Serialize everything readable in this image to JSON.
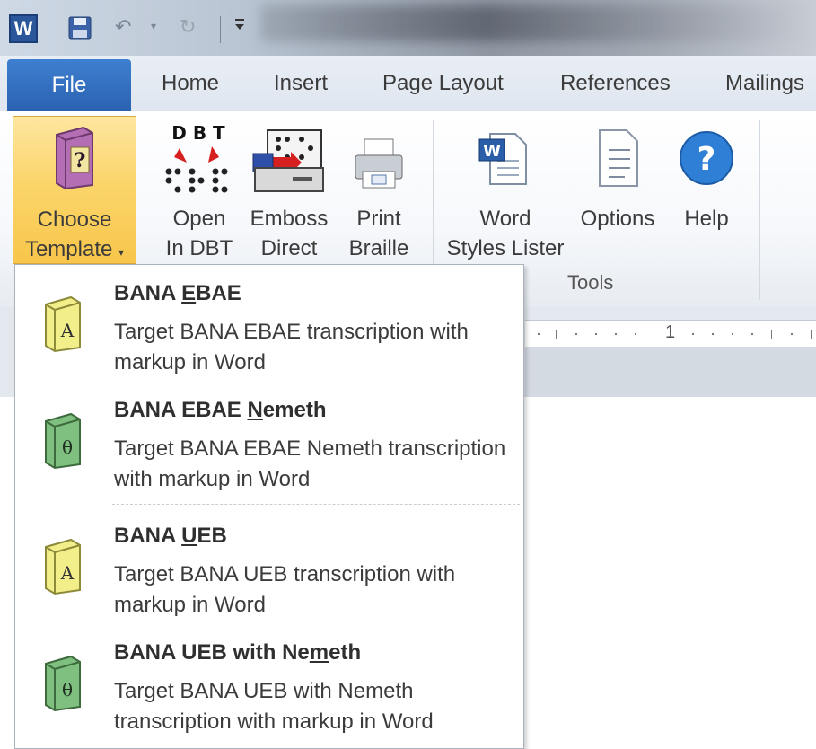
{
  "quick_access": {
    "app_icon_letter": "W",
    "icons": [
      "word-app-icon",
      "save-icon",
      "undo-icon",
      "redo-icon",
      "customize-toolbar-icon"
    ]
  },
  "tabs": {
    "file": "File",
    "home": "Home",
    "insert": "Insert",
    "page_layout": "Page Layout",
    "references": "References",
    "mailings": "Mailings"
  },
  "ribbon": {
    "choose_template": {
      "line1": "Choose",
      "line2": "Template",
      "icon": "book-question-icon"
    },
    "open_in_dbt": {
      "line1": "Open",
      "line2": "In DBT",
      "icon_text": "D B T",
      "icon": "dbt-braille-icon"
    },
    "emboss_direct": {
      "line1": "Emboss",
      "line2": "Direct",
      "icon": "embosser-icon"
    },
    "print_braille": {
      "line1": "Print",
      "line2": "Braille",
      "icon": "printer-icon"
    },
    "word_styles_lister": {
      "line1": "Word",
      "line2": "Styles Lister",
      "icon": "word-document-icon"
    },
    "options": {
      "line1": "Options",
      "icon": "options-document-icon"
    },
    "help": {
      "line1": "Help",
      "icon_text": "?",
      "icon": "help-icon"
    },
    "group_tools": "Tools"
  },
  "ruler": {
    "mark": "1"
  },
  "template_menu": {
    "items": [
      {
        "title_pre": "BANA ",
        "title_key": "E",
        "title_post": "BAE",
        "desc": "Target BANA EBAE transcription with markup in Word",
        "book_letter": "A",
        "book_color": "#f2ee8a"
      },
      {
        "title_pre": "BANA EBAE ",
        "title_key": "N",
        "title_post": "emeth",
        "desc": "Target BANA EBAE Nemeth transcription with markup in Word",
        "book_letter": "θ",
        "book_color": "#7fbf7f"
      },
      {
        "title_pre": "BANA ",
        "title_key": "U",
        "title_post": "EB",
        "desc": "Target BANA UEB transcription with markup in Word",
        "book_letter": "A",
        "book_color": "#f2ee8a"
      },
      {
        "title_pre": "BANA UEB with Ne",
        "title_key": "m",
        "title_post": "eth",
        "desc": "Target BANA UEB with Nemeth transcription with markup in Word",
        "book_letter": "θ",
        "book_color": "#7fbf7f"
      }
    ]
  },
  "colors": {
    "file_tab": "#2a62b0",
    "selected_button": "#fbd56b",
    "help_blue": "#2f7fd6"
  }
}
